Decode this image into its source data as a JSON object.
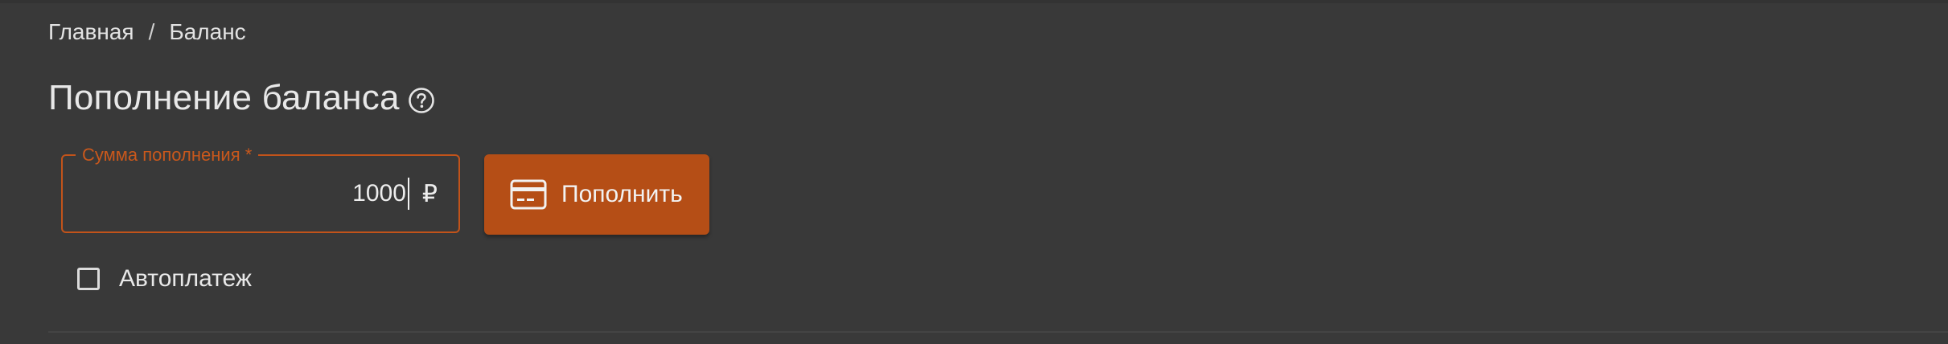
{
  "breadcrumb": {
    "home": "Главная",
    "separator": "/",
    "current": "Баланс"
  },
  "page": {
    "title": "Пополнение баланса",
    "help_icon": "question-circle-icon"
  },
  "form": {
    "amount_label": "Сумма пополнения *",
    "amount_value": "1000",
    "currency": "₽",
    "submit_label": "Пополнить",
    "submit_icon": "credit-card-icon",
    "autopay_label": "Автоплатеж",
    "autopay_checked": false
  },
  "colors": {
    "background": "#393939",
    "accent": "#b54e16",
    "accent_text": "#c9581c"
  }
}
